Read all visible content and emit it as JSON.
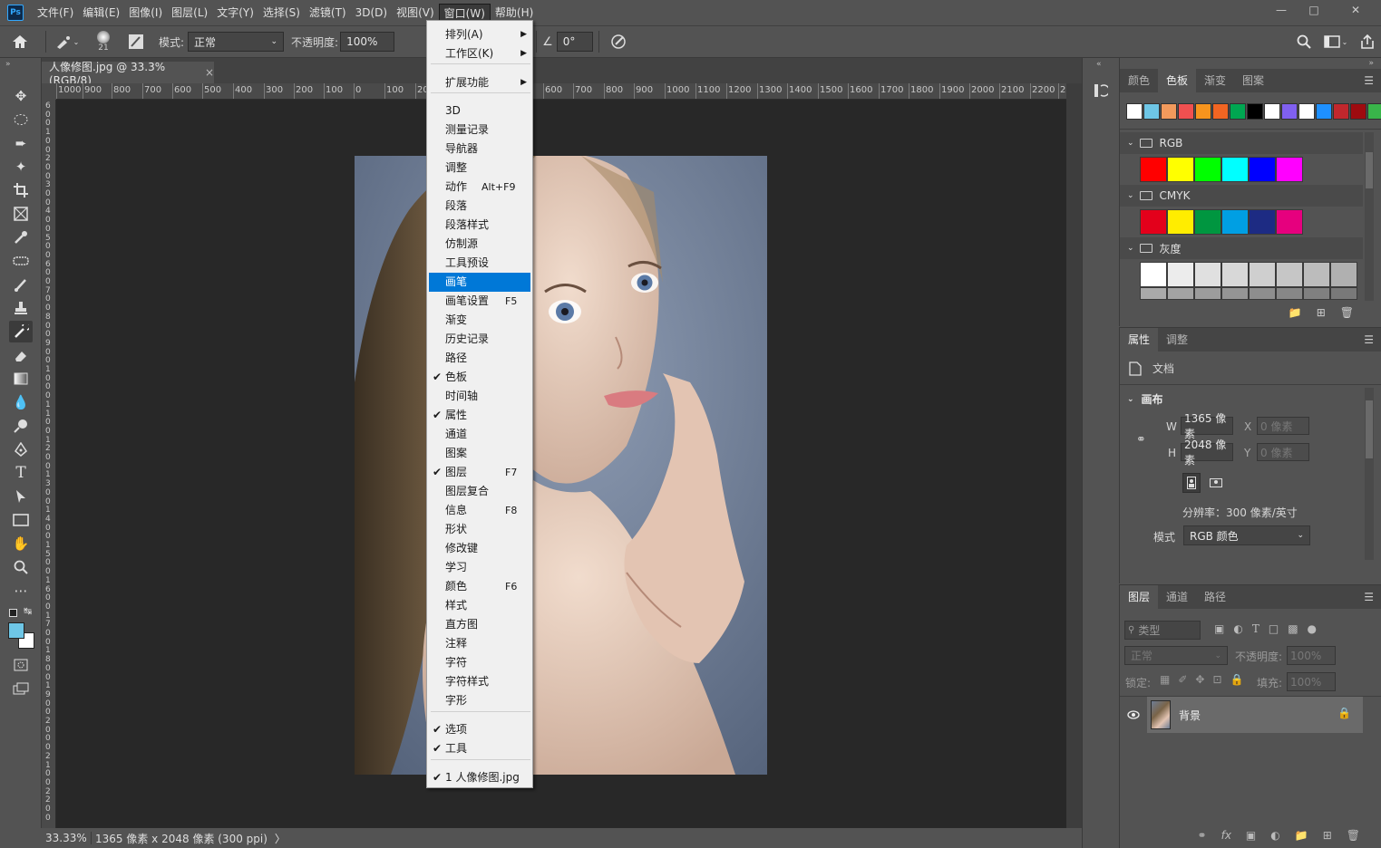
{
  "app": {
    "logo": "Ps"
  },
  "menubar": {
    "items": [
      "文件(F)",
      "编辑(E)",
      "图像(I)",
      "图层(L)",
      "文字(Y)",
      "选择(S)",
      "滤镜(T)",
      "3D(D)",
      "视图(V)",
      "窗口(W)",
      "帮助(H)"
    ],
    "active_index": 9
  },
  "window_controls": {
    "minimize": "▭",
    "restore": "□",
    "close": "✕"
  },
  "options": {
    "brush_size": "21",
    "mode_label": "模式:",
    "mode_value": "正常",
    "opacity_label": "不透明度:",
    "opacity_value": "100%",
    "angle_value": "0°"
  },
  "document": {
    "tab_title": "人像修图.jpg @ 33.3%(RGB/8)",
    "tab_close": "×",
    "ruler_h": [
      "1000",
      "900",
      "800",
      "700",
      "600",
      "500",
      "400",
      "300",
      "200",
      "100",
      "0",
      "100",
      "200",
      "600",
      "700",
      "800",
      "900",
      "1000",
      "1100",
      "1200",
      "1300",
      "1400",
      "1500",
      "1600",
      "1700",
      "1800",
      "1900",
      "2000",
      "2100",
      "2200",
      "230"
    ],
    "ruler_v": [
      "6",
      "0",
      "0",
      "1",
      "0",
      "0",
      "2",
      "0",
      "0",
      "3",
      "0",
      "0",
      "4",
      "0",
      "0",
      "5",
      "0",
      "0",
      "6",
      "0",
      "0",
      "7",
      "0",
      "0",
      "8",
      "0",
      "0",
      "9",
      "0",
      "0",
      "1",
      "0",
      "0",
      "0",
      "1",
      "1",
      "0",
      "0",
      "1",
      "2",
      "0",
      "0",
      "1",
      "3",
      "0",
      "0",
      "1",
      "4",
      "0",
      "0",
      "1",
      "5",
      "0",
      "0",
      "1",
      "6",
      "0",
      "0",
      "1",
      "7",
      "0",
      "0",
      "1",
      "8",
      "0",
      "0",
      "1",
      "9",
      "0",
      "0",
      "2",
      "0",
      "0",
      "0",
      "2",
      "1",
      "0",
      "0",
      "2",
      "2",
      "0",
      "0"
    ]
  },
  "status": {
    "zoom": "33.33%",
    "info": "1365 像素 x 2048 像素 (300 ppi)",
    "arrow": "〉"
  },
  "window_menu": {
    "items": [
      {
        "label": "排列(A)",
        "submenu": true
      },
      {
        "label": "工作区(K)",
        "submenu": true
      },
      {
        "label": "扩展功能",
        "submenu": true
      },
      {
        "label": "3D"
      },
      {
        "label": "测量记录"
      },
      {
        "label": "导航器"
      },
      {
        "label": "调整"
      },
      {
        "label": "动作",
        "shortcut": "Alt+F9"
      },
      {
        "label": "段落"
      },
      {
        "label": "段落样式"
      },
      {
        "label": "仿制源"
      },
      {
        "label": "工具预设"
      },
      {
        "label": "画笔",
        "highlighted": true
      },
      {
        "label": "画笔设置",
        "shortcut": "F5"
      },
      {
        "label": "渐变"
      },
      {
        "label": "历史记录"
      },
      {
        "label": "路径"
      },
      {
        "label": "色板",
        "checked": true
      },
      {
        "label": "时间轴"
      },
      {
        "label": "属性",
        "checked": true
      },
      {
        "label": "通道"
      },
      {
        "label": "图案"
      },
      {
        "label": "图层",
        "checked": true,
        "shortcut": "F7"
      },
      {
        "label": "图层复合"
      },
      {
        "label": "信息",
        "shortcut": "F8"
      },
      {
        "label": "形状"
      },
      {
        "label": "修改键"
      },
      {
        "label": "学习"
      },
      {
        "label": "颜色",
        "shortcut": "F6"
      },
      {
        "label": "样式"
      },
      {
        "label": "直方图"
      },
      {
        "label": "注释"
      },
      {
        "label": "字符"
      },
      {
        "label": "字符样式"
      },
      {
        "label": "字形"
      },
      {
        "label": "选项",
        "checked": true
      },
      {
        "label": "工具",
        "checked": true
      },
      {
        "label": "1 人像修图.jpg",
        "checked": true
      }
    ]
  },
  "swatches_panel": {
    "tabs": [
      "颜色",
      "色板",
      "渐变",
      "图案"
    ],
    "active_tab": 1,
    "recent": [
      "#ffffff",
      "#6ec6e6",
      "#f29a5c",
      "#f05050",
      "#f7941d",
      "#f26522",
      "#00a651",
      "#000000",
      "#ffffff",
      "#8060f0",
      "#ffffff",
      "#1e90ff",
      "#c1272d",
      "#9e0b0f",
      "#39b54a"
    ],
    "groups": [
      {
        "name": "RGB",
        "colors": [
          "#ff0000",
          "#ffff00",
          "#00ff00",
          "#00ffff",
          "#0000ff",
          "#ff00ff"
        ]
      },
      {
        "name": "CMYK",
        "colors": [
          "#e3001b",
          "#ffed00",
          "#009640",
          "#009fe3",
          "#1d2b83",
          "#e6007e"
        ]
      },
      {
        "name": "灰度",
        "colors": [
          "#ffffff",
          "#ececec",
          "#e0e0e0",
          "#d8d8d8",
          "#cfcfcf",
          "#c6c6c6",
          "#bcbcbc",
          "#b0b0b0"
        ]
      }
    ]
  },
  "properties_panel": {
    "tabs": [
      "属性",
      "调整"
    ],
    "active_tab": 0,
    "doc_label": "文档",
    "section": "画布",
    "w_label": "W",
    "w_value": "1365 像素",
    "h_label": "H",
    "h_value": "2048 像素",
    "x_label": "X",
    "x_value": "0 像素",
    "y_label": "Y",
    "y_value": "0 像素",
    "resolution": "分辨率：300 像素/英寸",
    "mode_label": "模式",
    "mode_value": "RGB 颜色"
  },
  "layers_panel": {
    "tabs": [
      "图层",
      "通道",
      "路径"
    ],
    "active_tab": 0,
    "filter_placeholder": "类型",
    "blend_mode": "正常",
    "opacity_label": "不透明度:",
    "opacity_value": "100%",
    "lock_label": "锁定:",
    "fill_label": "填充:",
    "fill_value": "100%",
    "layers": [
      {
        "name": "背景",
        "visible": true,
        "locked": true
      }
    ]
  },
  "colors": {
    "foreground": "#6ec6e6",
    "background": "#ffffff",
    "highlight": "#0078d7"
  }
}
